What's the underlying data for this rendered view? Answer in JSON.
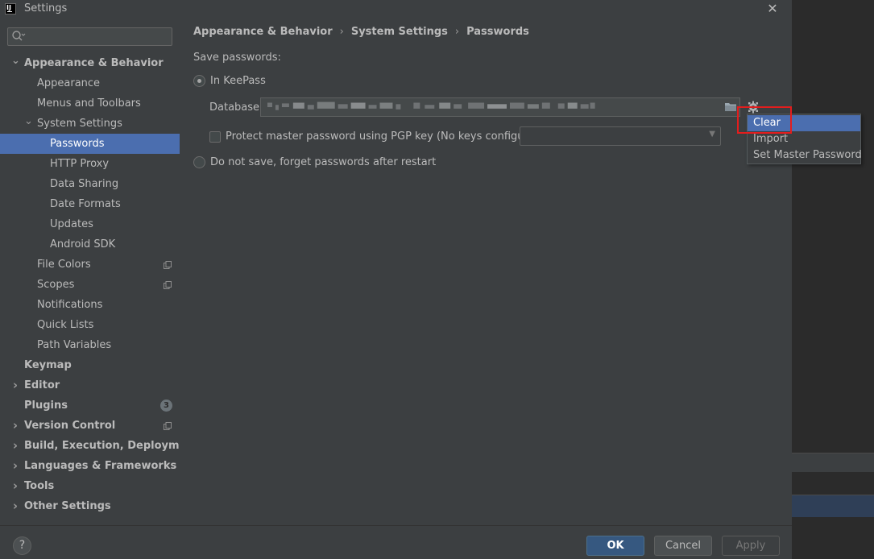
{
  "window": {
    "title": "Settings",
    "close_label": "✕"
  },
  "sidebar": {
    "search": {
      "placeholder": ""
    },
    "items": [
      {
        "label": "Appearance & Behavior",
        "level": 0,
        "bold": true,
        "arrow": "down"
      },
      {
        "label": "Appearance",
        "level": 1
      },
      {
        "label": "Menus and Toolbars",
        "level": 1
      },
      {
        "label": "System Settings",
        "level": 1,
        "arrow": "down"
      },
      {
        "label": "Passwords",
        "level": 2,
        "selected": true
      },
      {
        "label": "HTTP Proxy",
        "level": 2
      },
      {
        "label": "Data Sharing",
        "level": 2
      },
      {
        "label": "Date Formats",
        "level": 2
      },
      {
        "label": "Updates",
        "level": 2
      },
      {
        "label": "Android SDK",
        "level": 2
      },
      {
        "label": "File Colors",
        "level": 1,
        "icon": "copy-icon"
      },
      {
        "label": "Scopes",
        "level": 1,
        "icon": "copy-icon"
      },
      {
        "label": "Notifications",
        "level": 1
      },
      {
        "label": "Quick Lists",
        "level": 1
      },
      {
        "label": "Path Variables",
        "level": 1
      },
      {
        "label": "Keymap",
        "level": 0,
        "bold": true
      },
      {
        "label": "Editor",
        "level": 0,
        "bold": true,
        "arrow": "right"
      },
      {
        "label": "Plugins",
        "level": 0,
        "bold": true,
        "badge": "3"
      },
      {
        "label": "Version Control",
        "level": 0,
        "bold": true,
        "arrow": "right",
        "icon": "copy-icon"
      },
      {
        "label": "Build, Execution, Deployment",
        "level": 0,
        "bold": true,
        "arrow": "right"
      },
      {
        "label": "Languages & Frameworks",
        "level": 0,
        "bold": true,
        "arrow": "right"
      },
      {
        "label": "Tools",
        "level": 0,
        "bold": true,
        "arrow": "right"
      },
      {
        "label": "Other Settings",
        "level": 0,
        "bold": true,
        "arrow": "right"
      }
    ]
  },
  "breadcrumb": [
    "Appearance & Behavior",
    "System Settings",
    "Passwords"
  ],
  "passwords": {
    "save_label": "Save passwords:",
    "in_keepass_label": "In KeePass",
    "database_label": "Database:",
    "database_value_obscured": true,
    "protect_label": "Protect master password using PGP key (No keys configured)",
    "pgp_select_value": "",
    "do_not_save_label": "Do not save, forget passwords after restart"
  },
  "popup_menu": {
    "items": [
      "Clear",
      "Import",
      "Set Master Password"
    ],
    "active_index": 0
  },
  "buttons": {
    "ok": "OK",
    "cancel": "Cancel",
    "apply": "Apply",
    "help": "?"
  },
  "colors": {
    "selection": "#4b6eaf",
    "dialog_bg": "#3c3f41",
    "highlight_box": "#e31d1d",
    "ok_button": "#365880"
  }
}
